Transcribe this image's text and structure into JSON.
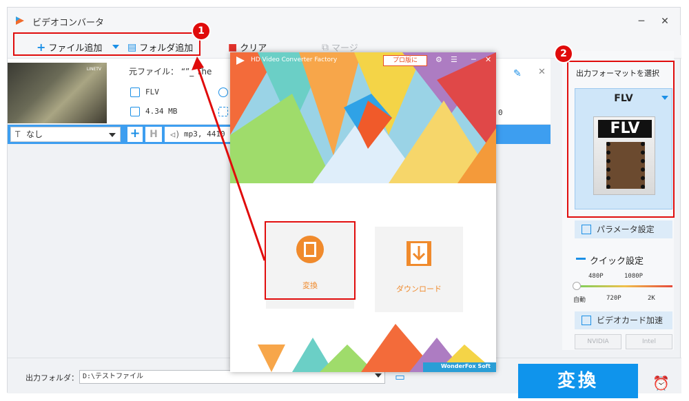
{
  "window": {
    "title": "ビデオコンバータ",
    "minimize": "─",
    "close": "✕"
  },
  "toolbar": {
    "add_file": "ファイル追加",
    "add_folder": "フォルダ追加",
    "clear": "クリア",
    "merge": "マージ"
  },
  "file_item": {
    "source_label": "元ファイル：",
    "source_name": "“”_  The",
    "format": "FLV",
    "size": "4.34 MB",
    "output_duration_fragment": "0",
    "thumbnail_label": "LINETV"
  },
  "subtitle_bar": {
    "subtitle_value": "なし",
    "audio_value": "mp3, 4410"
  },
  "popup": {
    "title": "HD Video Converter Factory",
    "pro_button": "プロ版に",
    "convert_label": "変換",
    "download_label": "ダウンロード",
    "brand": "WonderFox Soft"
  },
  "side": {
    "output_format_title": "出力フォーマットを選択",
    "format_name": "FLV",
    "format_image_text": "FLV",
    "param_settings": "パラメータ設定",
    "quick_settings": "クイック設定",
    "ticks_top": [
      "480P",
      "1080P"
    ],
    "ticks_bottom": [
      "自動",
      "720P",
      "2K"
    ],
    "gpu_accel": "ビデオカード加速",
    "nvidia": "NVIDIA",
    "intel": "Intel"
  },
  "bottom": {
    "output_folder_label": "出力フォルダ：",
    "output_folder_value": "D:\\テストファイル",
    "convert_button": "変換"
  },
  "annotations": {
    "badge_1": "1",
    "badge_2": "2"
  },
  "colors": {
    "accent_blue": "#0f94ec",
    "highlight_red": "#e00b0b",
    "popup_orange": "#f08a2c"
  }
}
